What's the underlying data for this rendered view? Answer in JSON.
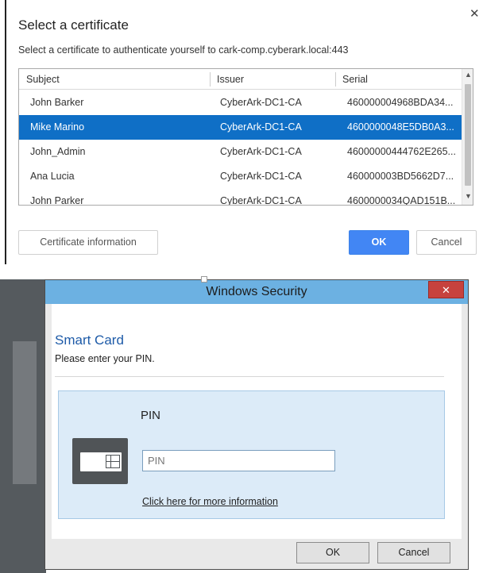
{
  "cert_dialog": {
    "title": "Select a certificate",
    "prompt": "Select a certificate to authenticate yourself to cark-comp.cyberark.local:443",
    "columns": {
      "subject": "Subject",
      "issuer": "Issuer",
      "serial": "Serial"
    },
    "rows": [
      {
        "subject": "John Barker",
        "issuer": "CyberArk-DC1-CA",
        "serial": "460000004968BDA34...",
        "selected": false
      },
      {
        "subject": "Mike Marino",
        "issuer": "CyberArk-DC1-CA",
        "serial": "4600000048E5DB0A3...",
        "selected": true
      },
      {
        "subject": "John_Admin",
        "issuer": "CyberArk-DC1-CA",
        "serial": "46000000444762E265...",
        "selected": false
      },
      {
        "subject": "Ana Lucia",
        "issuer": "CyberArk-DC1-CA",
        "serial": "460000003BD5662D7...",
        "selected": false
      },
      {
        "subject": "John Parker",
        "issuer": "CyberArk-DC1-CA",
        "serial": "4600000034QAD151B...",
        "selected": false
      }
    ],
    "buttons": {
      "info": "Certificate information",
      "ok": "OK",
      "cancel": "Cancel"
    },
    "close_icon": "close-icon",
    "accent_color": "#0f6fc6"
  },
  "win_dialog": {
    "title": "Windows Security",
    "heading": "Smart Card",
    "subheading": "Please enter your PIN.",
    "pin_label": "PIN",
    "pin_placeholder": "PIN",
    "more_info_link": "Click here for more information",
    "buttons": {
      "ok": "OK",
      "cancel": "Cancel"
    },
    "close_icon": "close-icon",
    "titlebar_color": "#6cb1e2"
  }
}
